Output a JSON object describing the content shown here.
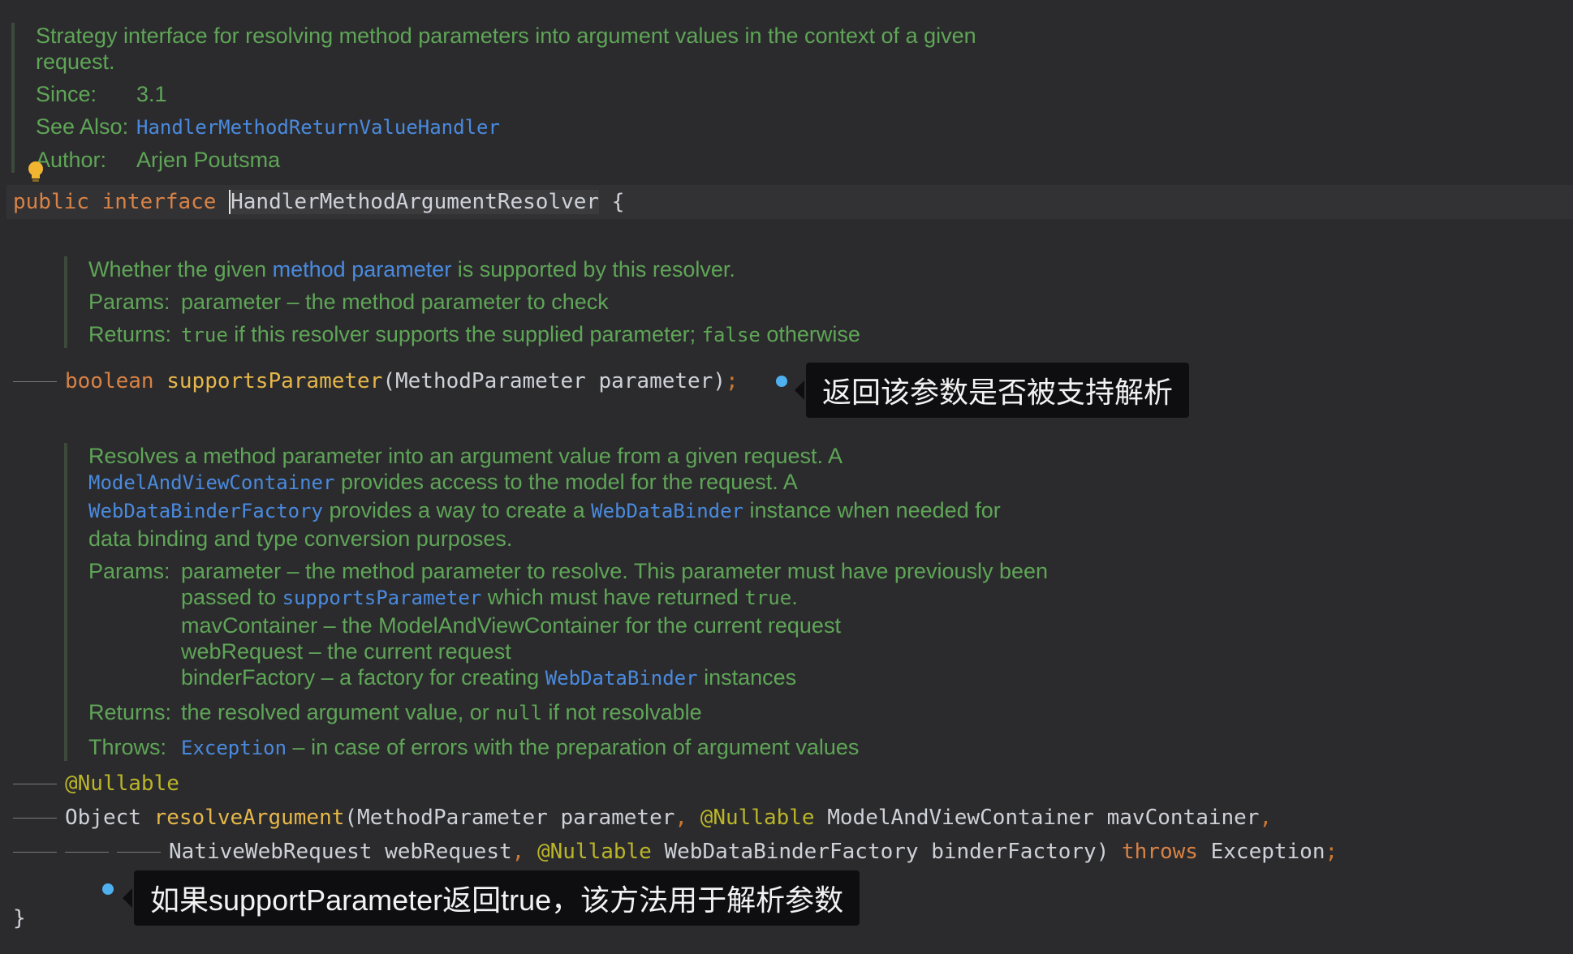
{
  "doc1": {
    "summary_line1": "Strategy interface for resolving method parameters into argument values in the context of a given",
    "summary_line2": "request.",
    "since_label": "Since:",
    "since_value": "3.1",
    "see_also_label": "See Also:",
    "see_also_value": "HandlerMethodReturnValueHandler",
    "author_label": "Author:",
    "author_value": "Arjen Poutsma"
  },
  "decl": {
    "public": "public",
    "interface": "interface",
    "name": "HandlerMethodArgumentResolver",
    "brace_open": "{",
    "brace_close": "}"
  },
  "doc2": {
    "line_pre": "Whether the given ",
    "line_link": "method parameter",
    "line_post": " is supported by this resolver.",
    "params_label": "Params:",
    "params_value": "parameter – the method parameter to check",
    "returns_label": "Returns:",
    "returns_true": "true",
    "returns_mid": " if this resolver supports the supplied parameter; ",
    "returns_false": "false",
    "returns_post": " otherwise"
  },
  "method1": {
    "type": "boolean",
    "name": "supportsParameter",
    "args": "(MethodParameter parameter)",
    "end": ";",
    "note": "返回该参数是否被支持解析"
  },
  "doc3": {
    "l1": "Resolves a method parameter into an argument value from a given request. A",
    "l2_link": "ModelAndViewContainer",
    "l2_post": " provides access to the model for the request. A",
    "l3_link1": "WebDataBinderFactory",
    "l3_mid": " provides a way to create a ",
    "l3_link2": "WebDataBinder",
    "l3_post": " instance when needed for",
    "l4": "data binding and type conversion purposes.",
    "params_label": "Params:",
    "p1": "parameter – the method parameter to resolve. This parameter must have previously been",
    "p2_pre": "passed to ",
    "p2_link": "supportsParameter",
    "p2_mid": " which must have returned ",
    "p2_true": "true",
    "p2_post": ".",
    "p3": "mavContainer – the ModelAndViewContainer for the current request",
    "p4": "webRequest – the current request",
    "p5_pre": "binderFactory – a factory for creating ",
    "p5_link": "WebDataBinder",
    "p5_post": " instances",
    "returns_label": "Returns:",
    "returns_pre": "the resolved argument value, or ",
    "returns_null": "null",
    "returns_post": " if not resolvable",
    "throws_label": "Throws:",
    "throws_link": "Exception",
    "throws_post": " – in case of errors with the preparation of argument values"
  },
  "method2": {
    "annotation": "@Nullable",
    "ret_type": "Object",
    "name": "resolveArgument",
    "args1_a": "(MethodParameter parameter",
    "comma": ",",
    "args1_ann": "@Nullable",
    "args1_b": " ModelAndViewContainer mavContainer",
    "args2_a": "NativeWebRequest webRequest",
    "args2_ann": "@Nullable",
    "args2_b": " WebDataBinderFactory binderFactory)",
    "throws": "throws",
    "exception": " Exception",
    "end": ";",
    "note": "如果supportParameter返回true，该方法用于解析参数"
  }
}
